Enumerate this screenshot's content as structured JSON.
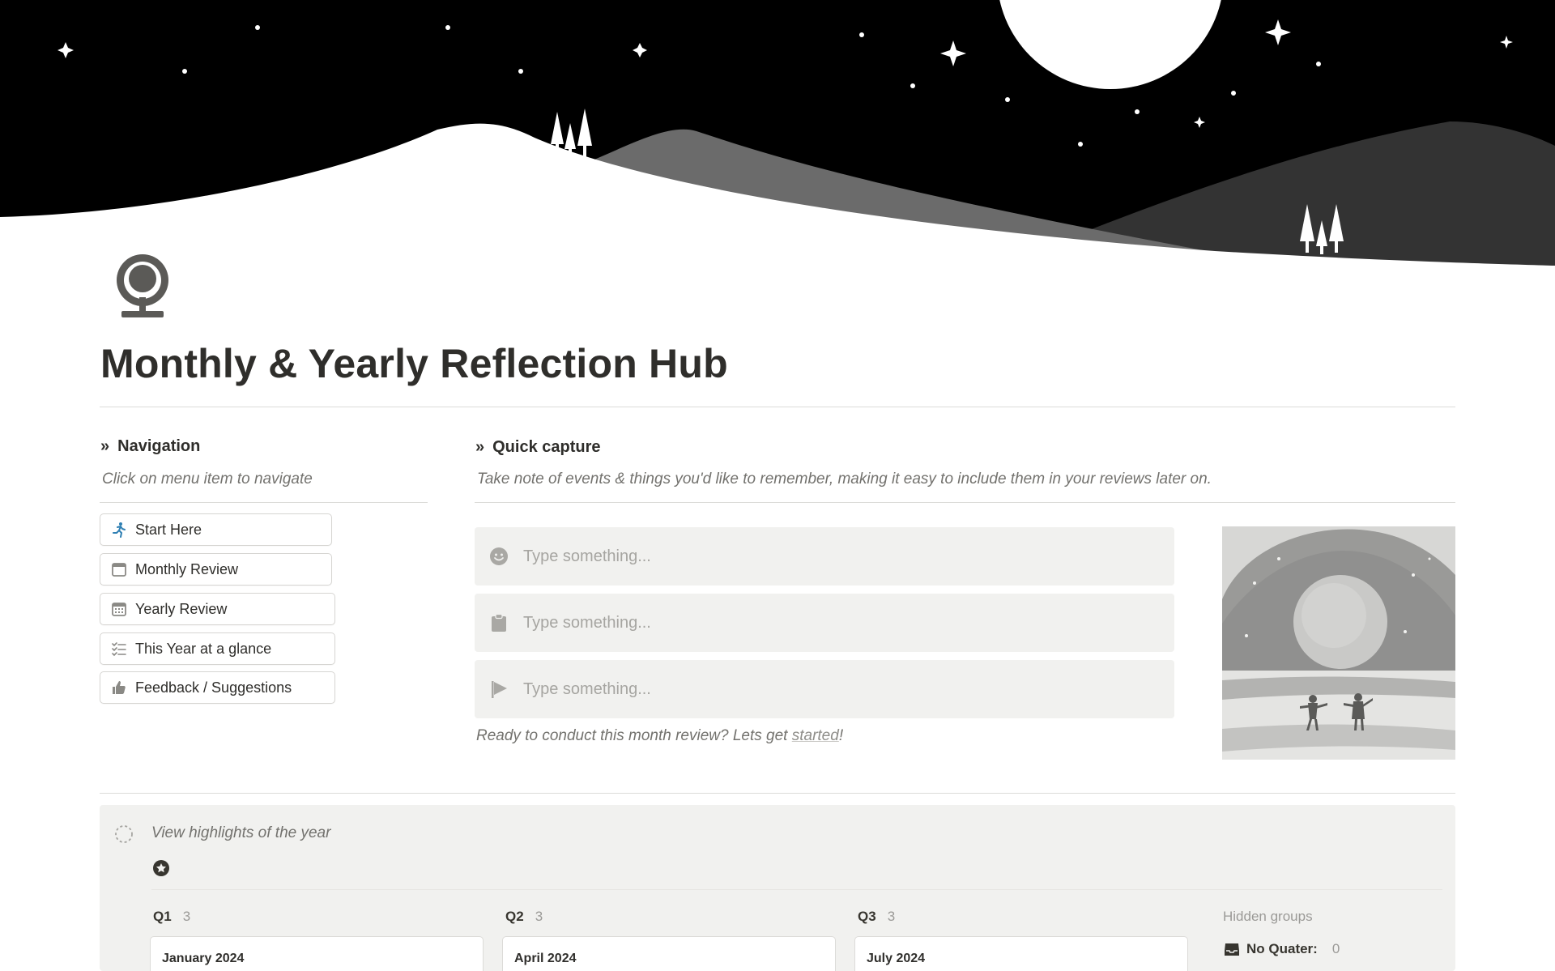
{
  "page": {
    "title": "Monthly & Yearly Reflection Hub",
    "icon": "vanity-mirror-icon"
  },
  "navigation": {
    "heading": "Navigation",
    "hint": "Click on menu item to navigate",
    "items": [
      {
        "label": "Start Here",
        "icon": "running-person-icon"
      },
      {
        "label": "Monthly Review",
        "icon": "calendar-icon"
      },
      {
        "label": "Yearly Review",
        "icon": "calendar-grid-icon"
      },
      {
        "label": "This Year at a glance",
        "icon": "checklist-icon"
      },
      {
        "label": "Feedback / Suggestions",
        "icon": "thumbs-up-icon"
      }
    ]
  },
  "quick_capture": {
    "heading": "Quick capture",
    "hint": "Take note of events & things you'd like to remember, making it easy to include them in your reviews later on.",
    "fields": [
      {
        "icon": "smiley-icon",
        "placeholder": "Type something..."
      },
      {
        "icon": "clipboard-icon",
        "placeholder": "Type something..."
      },
      {
        "icon": "flag-icon",
        "placeholder": "Type something..."
      }
    ],
    "ready_prefix": "Ready to conduct this month review? Lets get ",
    "ready_link": "started",
    "ready_suffix": "!"
  },
  "highlights": {
    "title": "View highlights of the year",
    "groups": [
      {
        "name": "Q1",
        "count": "3",
        "first_card": "January 2024"
      },
      {
        "name": "Q2",
        "count": "3",
        "first_card": "April 2024"
      },
      {
        "name": "Q3",
        "count": "3",
        "first_card": "July 2024"
      }
    ],
    "hidden_groups_label": "Hidden groups",
    "hidden_group": {
      "name": "No Quater:",
      "count": "0",
      "icon": "inbox-icon"
    }
  },
  "colors": {
    "sky": "#000000",
    "field_bg": "#f1f1ef",
    "text": "#37352f",
    "muted": "#73726e",
    "start_icon": "#2e7fb3"
  }
}
